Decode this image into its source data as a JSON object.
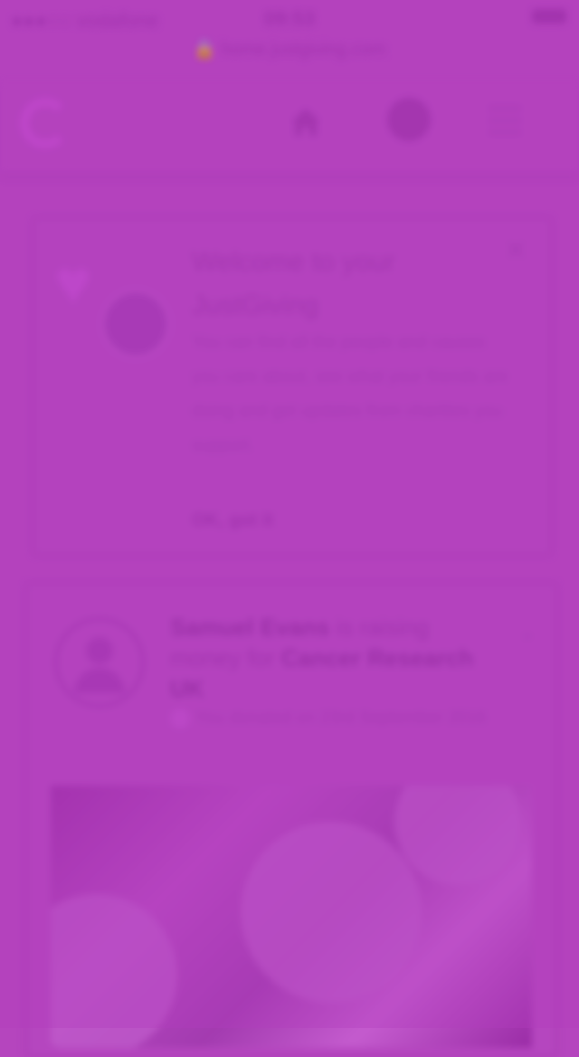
{
  "status_bar": {
    "carrier": "●●●○○ vodafone",
    "time": "09:53"
  },
  "browser": {
    "url": "home.justgiving.com"
  },
  "nav": {
    "logo_text": "G",
    "home_label": "Home",
    "profile_label": "Profile",
    "menu_label": "Menu"
  },
  "welcome_card": {
    "title": "Welcome to your JustGiving",
    "body": "You can find all the people and causes you care about, see what your friends are doing and get updates from charities you support.",
    "link": "OK, got it"
  },
  "post_card": {
    "author": "Samuel Evans",
    "action": "is raising money for",
    "cause": "Cancer Research UK",
    "meta": "You donated on 23rd September 2016"
  },
  "colors": {
    "background": "#b545be",
    "accent": "#9a2fa6"
  }
}
